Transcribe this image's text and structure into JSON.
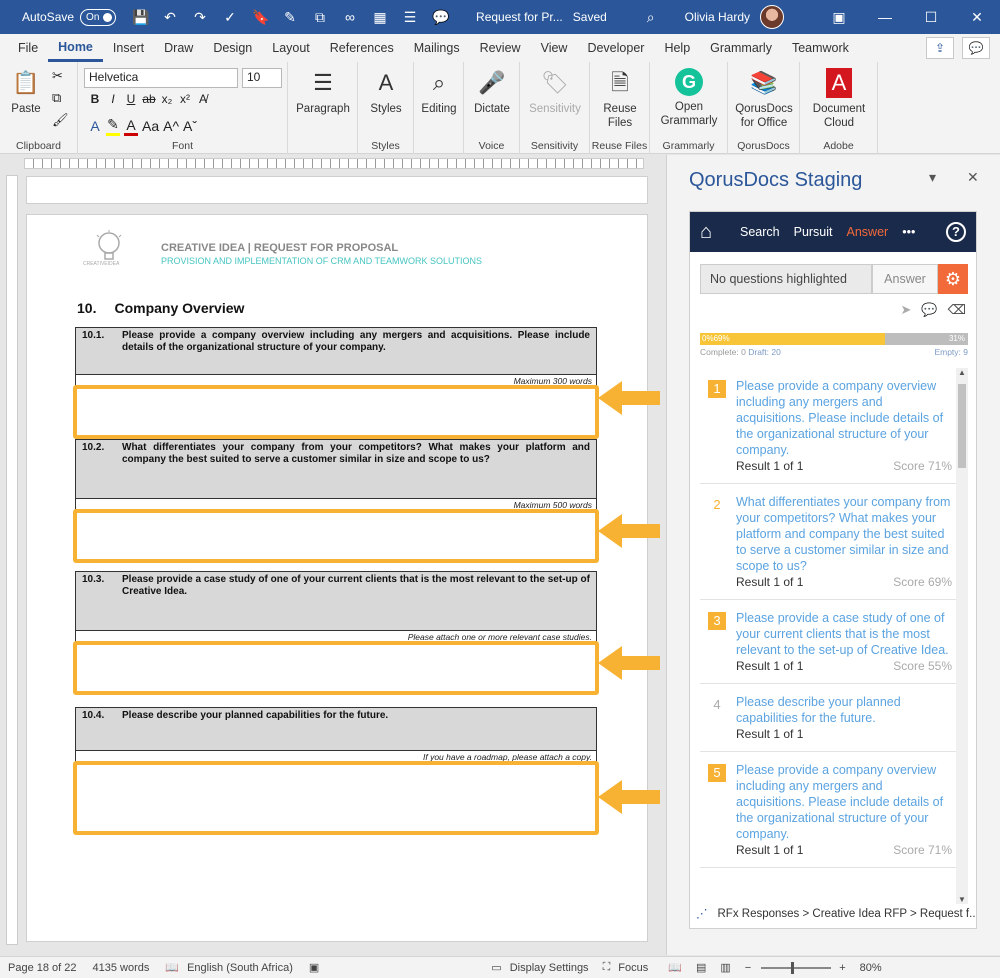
{
  "titlebar": {
    "autosave": "AutoSave",
    "toggle": "On",
    "doc_title": "Request for Pr...",
    "saved": "Saved",
    "user": "Olivia Hardy"
  },
  "tabs": [
    "File",
    "Home",
    "Insert",
    "Draw",
    "Design",
    "Layout",
    "References",
    "Mailings",
    "Review",
    "View",
    "Developer",
    "Help",
    "Grammarly",
    "Teamwork"
  ],
  "ribbon": {
    "paste": "Paste",
    "clipboard": "Clipboard",
    "font_name": "Helvetica",
    "font_size": "10",
    "font": "Font",
    "paragraph": "Paragraph",
    "styles": "Styles",
    "styles_group": "Styles",
    "editing": "Editing",
    "dictate": "Dictate",
    "voice": "Voice",
    "sensitivity": "Sensitivity",
    "sensitivity_group": "Sensitivity",
    "reuse_files_1": "Reuse",
    "reuse_files_2": "Files",
    "reuse_group": "Reuse Files",
    "open_grammarly_1": "Open",
    "open_grammarly_2": "Grammarly",
    "grammarly_group": "Grammarly",
    "qorus_1": "QorusDocs",
    "qorus_2": "for Office",
    "qorus_group": "QorusDocs",
    "doc_cloud_1": "Document",
    "doc_cloud_2": "Cloud",
    "adobe_group": "Adobe"
  },
  "document": {
    "header_title": "CREATIVE IDEA | REQUEST FOR PROPOSAL",
    "header_sub": "PROVISION AND IMPLEMENTATION OF CRM AND TEAMWORK SOLUTIONS",
    "logo_text": "CREATIVEIDEA",
    "section_num": "10.",
    "section_title": "Company Overview",
    "questions": [
      {
        "num": "10.1.",
        "text": "Please provide a company overview including any mergers and acquisitions. Please include details of the organizational structure of your company.",
        "note": "Maximum 300 words"
      },
      {
        "num": "10.2.",
        "text": "What differentiates your company from your competitors? What makes your platform and company the best suited to serve a customer similar in size and scope to us?",
        "note": "Maximum 500 words"
      },
      {
        "num": "10.3.",
        "text": "Please provide a case study of one of your current clients that is the most relevant to the set-up of Creative Idea.",
        "note": "Please attach one or more relevant case studies."
      },
      {
        "num": "10.4.",
        "text": "Please describe your planned capabilities for the future.",
        "note": "If you have a roadmap, please attach a copy."
      }
    ]
  },
  "pane": {
    "title": "QorusDocs Staging",
    "nav": {
      "search": "Search",
      "pursuit": "Pursuit",
      "answer": "Answer",
      "more": "•••",
      "help": "?"
    },
    "question_placeholder": "No questions highlighted",
    "answer_btn": "Answer",
    "progress": {
      "complete_pct": 0,
      "draft_pct": 69,
      "empty_pct": 31,
      "label_left": "0%69%",
      "label_right": "31%"
    },
    "stats": {
      "complete": "Complete: 0",
      "draft": "Draft: 20",
      "empty": "Empty: 9"
    },
    "results": [
      {
        "num": "1",
        "style": "filled",
        "text": "Please provide a company overview including any mergers and acquisitions. Please include details of the organizational structure of your company.",
        "result": "Result 1 of 1",
        "score": "Score 71%"
      },
      {
        "num": "2",
        "style": "outline",
        "text": "What differentiates your company from your competitors? What makes your platform and company the best suited to serve a customer similar in size and scope to us?",
        "result": "Result 1 of 1",
        "score": "Score 69%"
      },
      {
        "num": "3",
        "style": "filled",
        "text": "Please provide a case study of one of your current clients that is the most relevant to the set-up of Creative Idea.",
        "result": "Result 1 of 1",
        "score": "Score 55%"
      },
      {
        "num": "4",
        "style": "grey",
        "text": "Please describe your planned capabilities for the future.",
        "result": "Result 1 of 1",
        "score": ""
      },
      {
        "num": "5",
        "style": "filled",
        "text": "Please provide a company overview including any mergers and acquisitions. Please include details of the organizational structure of your company.",
        "result": "Result 1 of 1",
        "score": "Score 71%"
      }
    ],
    "breadcrumb": "RFx Responses > Creative Idea RFP > Request f..."
  },
  "statusbar": {
    "page": "Page 18 of 22",
    "words": "4135 words",
    "language": "English (South Africa)",
    "display": "Display Settings",
    "focus": "Focus",
    "zoom": "80%"
  },
  "colors": {
    "word_blue": "#2b579a",
    "highlight": "#f7b234",
    "qorus_orange": "#f26a3a",
    "nav_dark": "#1a2a4a",
    "link_blue": "#5ba3e0"
  }
}
